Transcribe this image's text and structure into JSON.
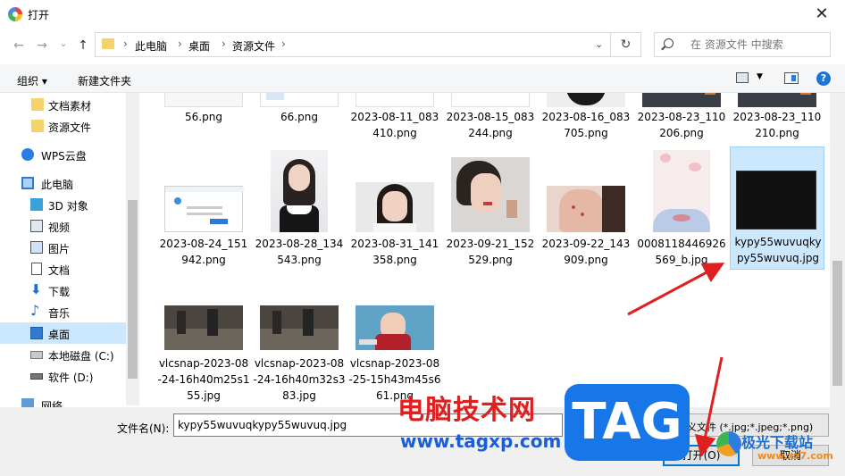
{
  "window": {
    "title": "打开",
    "close": "✕"
  },
  "nav": {
    "back": "←",
    "forward": "→",
    "recent": "⌄",
    "up": "↑",
    "breadcrumbs": [
      "此电脑",
      "桌面",
      "资源文件"
    ],
    "refresh": "↻",
    "search_placeholder": "在 资源文件 中搜索"
  },
  "toolbar": {
    "organize": "组织 ▾",
    "new_folder": "新建文件夹"
  },
  "sidebar": {
    "items": [
      {
        "label": "文档素材",
        "icon": "folder-icon"
      },
      {
        "label": "资源文件",
        "icon": "folder-icon"
      },
      {
        "label": "WPS云盘",
        "icon": "cloud-icon"
      },
      {
        "label": "此电脑",
        "icon": "computer-icon"
      },
      {
        "label": "3D 对象",
        "icon": "cube-icon"
      },
      {
        "label": "视频",
        "icon": "video-icon"
      },
      {
        "label": "图片",
        "icon": "pictures-icon"
      },
      {
        "label": "文档",
        "icon": "documents-icon"
      },
      {
        "label": "下载",
        "icon": "download-icon"
      },
      {
        "label": "音乐",
        "icon": "music-icon"
      },
      {
        "label": "桌面",
        "icon": "desktop-icon"
      },
      {
        "label": "本地磁盘 (C:)",
        "icon": "drive-icon"
      },
      {
        "label": "软件 (D:)",
        "icon": "drive-icon"
      },
      {
        "label": "网络",
        "icon": "network-icon"
      }
    ]
  },
  "files": {
    "row1": [
      "56.png",
      "66.png",
      "2023-08-11_083410.png",
      "2023-08-15_083244.png",
      "2023-08-16_083705.png",
      "2023-08-23_110206.png",
      "2023-08-23_110210.png"
    ],
    "row2": [
      "2023-08-24_151942.png",
      "2023-08-28_134543.png",
      "2023-08-31_141358.png",
      "2023-09-21_152529.png",
      "2023-09-22_143909.png",
      "0008118446926569_b.jpg",
      "kypy55wuvuqkypy55wuvuq.jpg"
    ],
    "row3": [
      "vlcsnap-2023-08-24-16h40m25s155.jpg",
      "vlcsnap-2023-08-24-16h40m32s383.jpg",
      "vlcsnap-2023-08-25-15h43m45s661.png"
    ]
  },
  "bottom": {
    "filename_label": "文件名(N):",
    "filename_value": "kypy55wuvuqkypy55wuvuq.jpg",
    "file_type": "自定义文件 (*.jpg;*.jpeg;*.png)",
    "open_label": "打开(O)",
    "cancel_label": "取消"
  },
  "watermark": {
    "site_name": "电脑技术网",
    "site_url": "www.tagxp.com",
    "tag": "TAG",
    "logo_text": "极光下载站",
    "logo_url": "www.xz7.com"
  },
  "colors": {
    "selection": "#cce8ff",
    "accent": "#0078d7",
    "arrow": "#e02020"
  }
}
